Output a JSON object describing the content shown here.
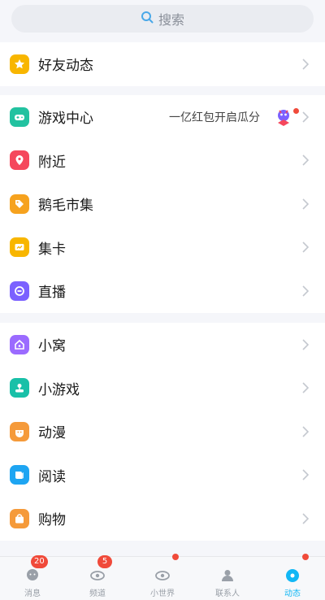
{
  "search": {
    "label": "搜索",
    "icon": "search-icon"
  },
  "groups": [
    [
      {
        "key": "friends",
        "label": "好友动态",
        "icon": "star-icon",
        "color": "#f8b600"
      }
    ],
    [
      {
        "key": "game",
        "label": "游戏中心",
        "icon": "gamepad-icon",
        "color": "#22c2a0",
        "extra": "一亿红包开启瓜分"
      },
      {
        "key": "nearby",
        "label": "附近",
        "icon": "location-pin-icon",
        "color": "#f5475c"
      },
      {
        "key": "market",
        "label": "鹅毛市集",
        "icon": "tag-icon",
        "color": "#f6a21e"
      },
      {
        "key": "cards",
        "label": "集卡",
        "icon": "card-icon",
        "color": "#f8b600"
      },
      {
        "key": "live",
        "label": "直播",
        "icon": "live-icon",
        "color": "#7b61ff"
      }
    ],
    [
      {
        "key": "nest",
        "label": "小窝",
        "icon": "house-icon",
        "color": "#9b6bff"
      },
      {
        "key": "minigame",
        "label": "小游戏",
        "icon": "joystick-icon",
        "color": "#19c0a8"
      },
      {
        "key": "anime",
        "label": "动漫",
        "icon": "anime-icon",
        "color": "#f59a3a"
      },
      {
        "key": "read",
        "label": "阅读",
        "icon": "book-icon",
        "color": "#1ea5f2"
      },
      {
        "key": "shop",
        "label": "购物",
        "icon": "shopping-icon",
        "color": "#f59a3a"
      }
    ]
  ],
  "tabs": [
    {
      "label": "消息",
      "icon": "message-icon",
      "badge": "20"
    },
    {
      "label": "频道",
      "icon": "channel-icon",
      "badge": "5"
    },
    {
      "label": "小世界",
      "icon": "world-icon",
      "dot": true
    },
    {
      "label": "联系人",
      "icon": "contacts-icon"
    },
    {
      "label": "动态",
      "icon": "dynamic-icon",
      "dot": true,
      "active": true
    }
  ],
  "colors": {
    "accent": "#12b7f5",
    "badge": "#f04a3a",
    "background": "#f5f6fa"
  }
}
